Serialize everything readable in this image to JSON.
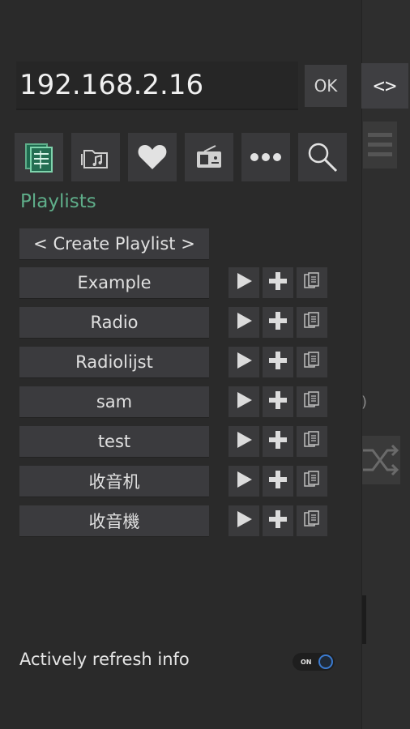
{
  "header": {
    "ip_address": "192.168.2.16",
    "ok_label": "OK",
    "toggle_label": "<>"
  },
  "toolbar": {
    "items": [
      {
        "icon": "queue-icon",
        "active": true
      },
      {
        "icon": "music-folder-icon"
      },
      {
        "icon": "heart-icon"
      },
      {
        "icon": "radio-icon"
      },
      {
        "icon": "more-icon"
      },
      {
        "icon": "search-icon"
      }
    ]
  },
  "playlists": {
    "title": "Playlists",
    "create_label": "< Create Playlist >",
    "items": [
      {
        "name": "Example"
      },
      {
        "name": "Radio"
      },
      {
        "name": "Radiolijst"
      },
      {
        "name": "sam"
      },
      {
        "name": "test"
      },
      {
        "name": "收音机"
      },
      {
        "name": "收音機"
      }
    ]
  },
  "settings": {
    "refresh_label": "Actively refresh info",
    "refresh_toggle_text": "ON",
    "refresh_on": true
  },
  "background": {
    "paren_text": ")"
  },
  "colors": {
    "accent_green": "#5fae8a",
    "toggle_blue": "#3b7bd0",
    "panel": "#2a2a2a",
    "button": "#3b3b3e"
  }
}
